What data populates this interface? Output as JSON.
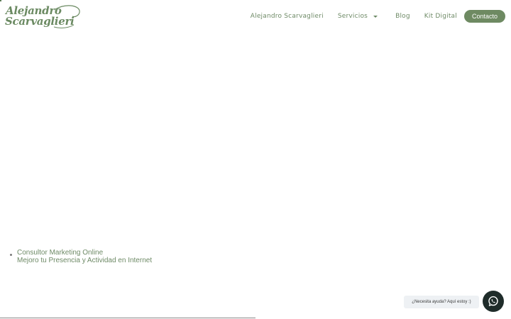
{
  "brand": {
    "line1": "Alejandro",
    "line2": "Scarvaglieri",
    "color": "#6b8a62"
  },
  "nav": {
    "items": [
      {
        "label": "Alejandro Scarvaglieri"
      },
      {
        "label": "Servicios"
      },
      {
        "label": "Blog"
      },
      {
        "label": "Kit Digital"
      }
    ],
    "contact_label": "Contacto",
    "accent": "#6e8a62"
  },
  "hero": {
    "title": "Consultor Marketing Online",
    "subtitle": "Mejoro tu Presencia y Actividad en Internet"
  },
  "whatsapp": {
    "bubble_text": "¿Necesita ayuda? Aquí estoy :)",
    "icon": "whatsapp-icon",
    "button_color": "#1f2c2a"
  }
}
